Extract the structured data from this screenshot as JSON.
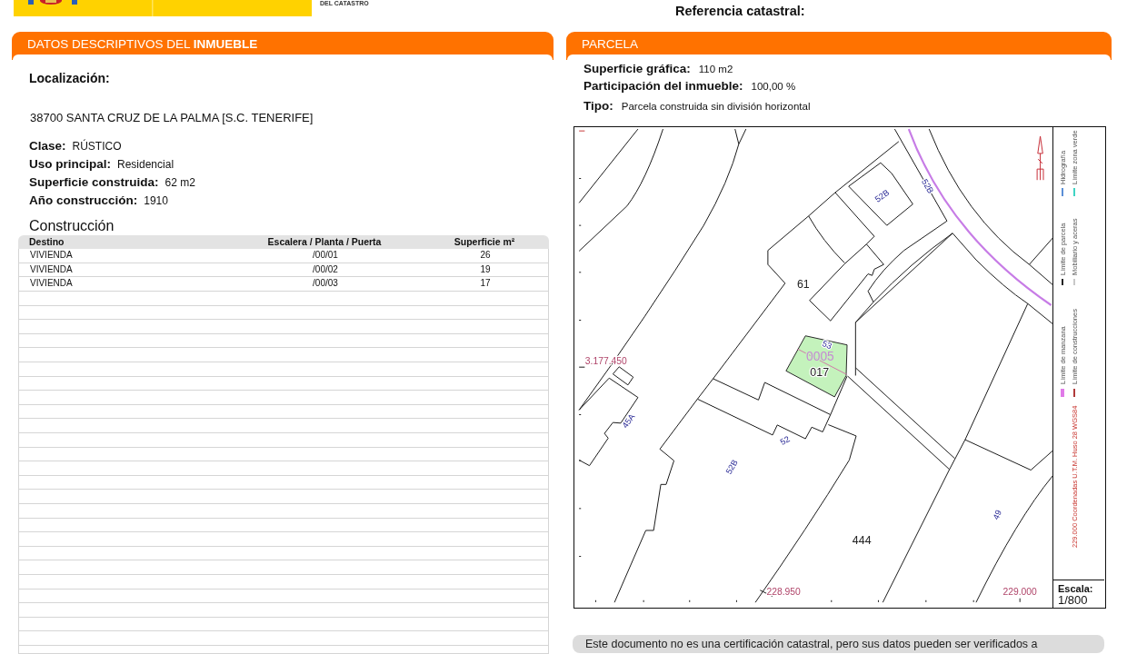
{
  "header": {
    "logo_caption": "DEL CATASTRO",
    "reference_label": "Referencia catastral:"
  },
  "property": {
    "title": "DATOS DESCRIPTIVOS DEL **INMUEBLE**",
    "location_label": "Localización:",
    "address": "38700 SANTA CRUZ DE LA PALMA [S.C. TENERIFE]",
    "fields": [
      {
        "label": "Clase:",
        "value": "RÚSTICO"
      },
      {
        "label": "Uso principal:",
        "value": "Residencial"
      },
      {
        "label": "Superficie construida:",
        "value": "62 m2"
      },
      {
        "label": "Año construcción:",
        "value": "1910"
      }
    ],
    "construction": {
      "title": "Construcción",
      "columns": [
        "Destino",
        "Escalera / Planta / Puerta",
        "Superficie m²"
      ],
      "rows": [
        [
          "VIVIENDA",
          "/00/01",
          "26"
        ],
        [
          "VIVIENDA",
          "/00/02",
          "19"
        ],
        [
          "VIVIENDA",
          "/00/03",
          "17"
        ]
      ]
    }
  },
  "parcel": {
    "title": "PARCELA",
    "fields": [
      {
        "label": "Superficie gráfica:",
        "value": "110 m2"
      },
      {
        "label": "Participación del inmueble:",
        "value": "100,00 %"
      },
      {
        "label": "Tipo:",
        "value": "Parcela construida sin división horizontal"
      }
    ],
    "map": {
      "labels": [
        {
          "text": "52B",
          "kind": "street_number"
        },
        {
          "text": "52B",
          "kind": "street_number"
        },
        {
          "text": "61",
          "kind": "parcel"
        },
        {
          "text": "53",
          "kind": "street_number"
        },
        {
          "text": "0005",
          "kind": "subparcel"
        },
        {
          "text": "3.177.450",
          "kind": "coordinate"
        },
        {
          "text": "017",
          "kind": "parcel"
        },
        {
          "text": "45A",
          "kind": "street_number"
        },
        {
          "text": "52",
          "kind": "street_number"
        },
        {
          "text": "52B",
          "kind": "street_number"
        },
        {
          "text": "49",
          "kind": "street_number"
        },
        {
          "text": "444",
          "kind": "parcel"
        },
        {
          "text": "228.950",
          "kind": "coordinate"
        },
        {
          "text": "229.000",
          "kind": "coordinate"
        }
      ],
      "legend": [
        {
          "label": "Límite de manzana",
          "kind": "band",
          "color": "#e07ae8"
        },
        {
          "label": "Límite de parcela",
          "kind": "line",
          "color": "#222222"
        },
        {
          "label": "Hidrografía",
          "kind": "line",
          "color": "#5b8fd6"
        },
        {
          "label": "Límite de construcciones",
          "kind": "line",
          "color": "#b03a3a"
        },
        {
          "label": "Mobiliario y aceras",
          "kind": "line",
          "color": "#c8c8c8"
        },
        {
          "label": "Límite zona verde",
          "kind": "line",
          "color": "#3fd4c4"
        }
      ],
      "coordinate_note": "229.000 Coordenadas U.T.M. Huso 28 WGS84",
      "scale_label": "Escala:",
      "scale_value": "1/800"
    }
  },
  "notice": "Este documento no es una certificación catastral, pero sus datos pueden ser verificados a"
}
